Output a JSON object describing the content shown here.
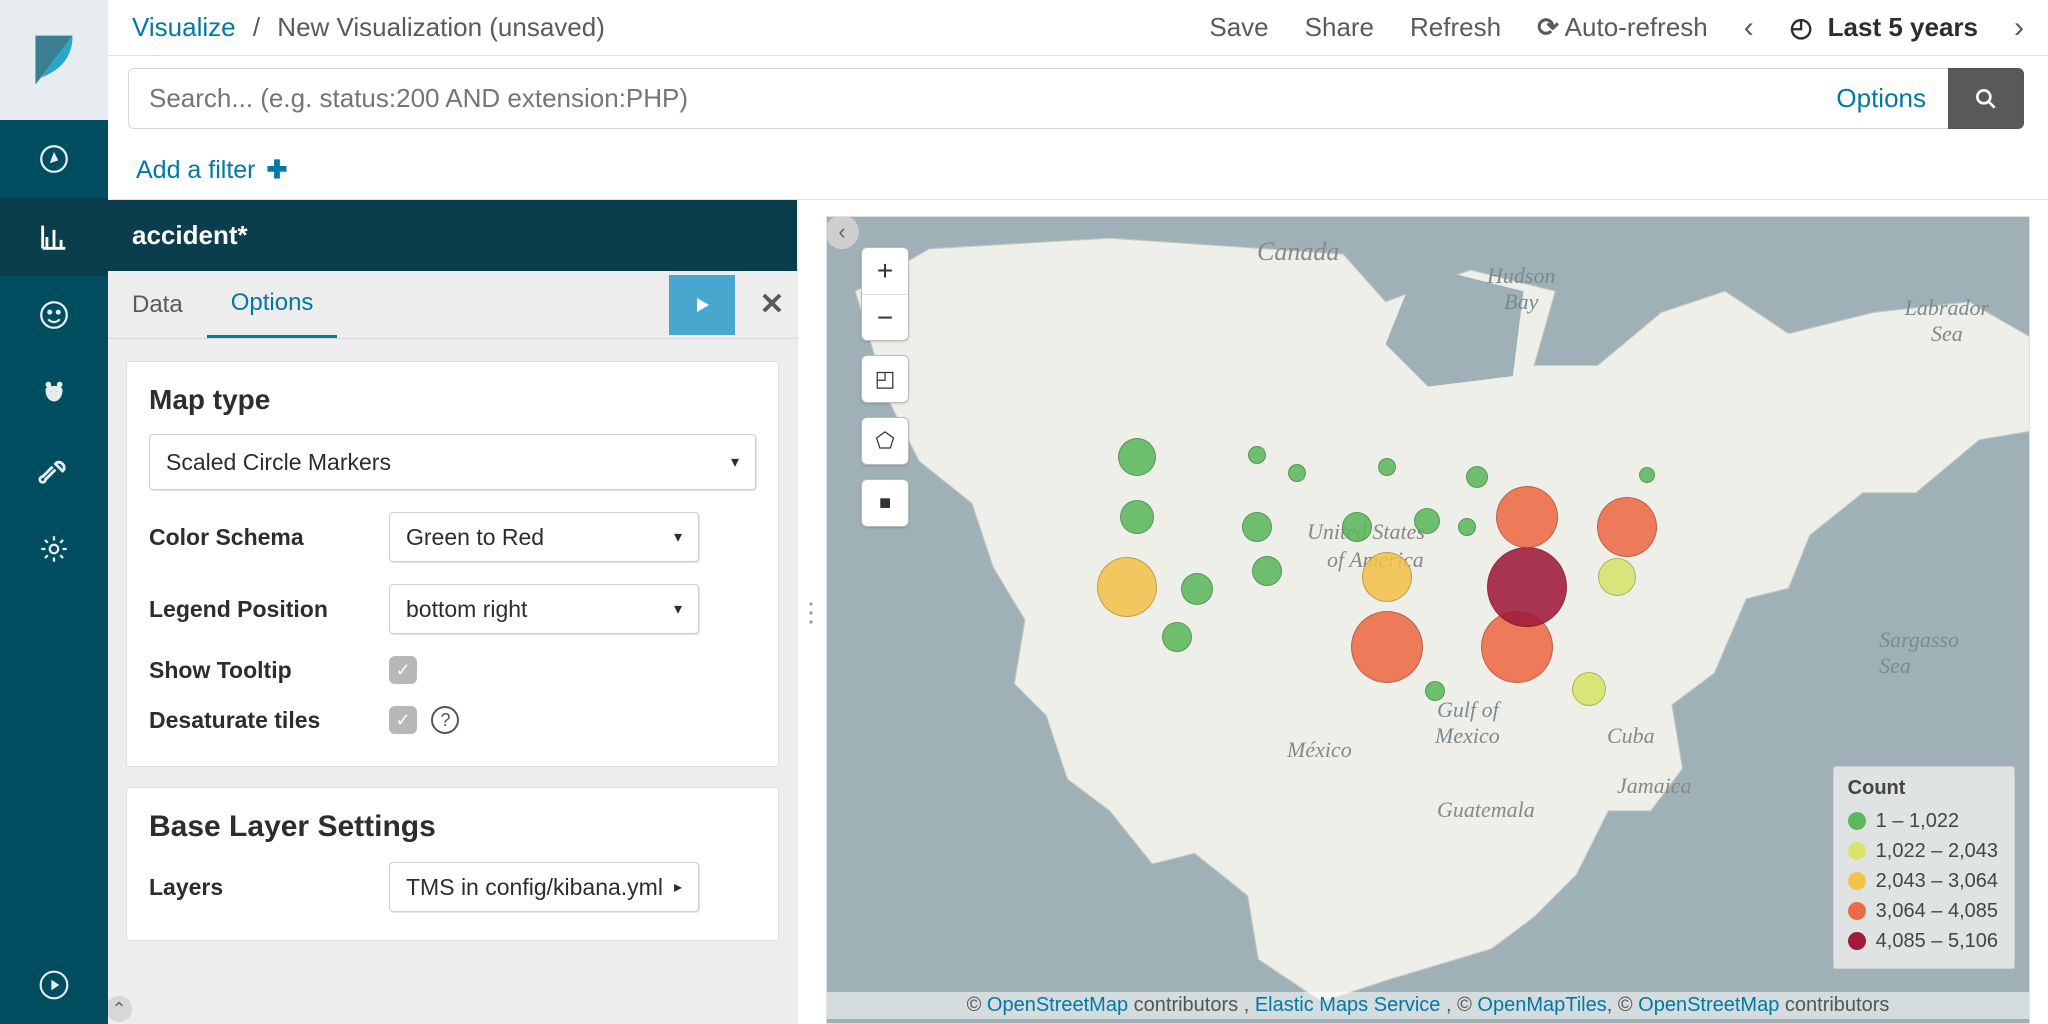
{
  "breadcrumb": {
    "root": "Visualize",
    "current": "New Visualization (unsaved)"
  },
  "top_actions": {
    "save": "Save",
    "share": "Share",
    "refresh": "Refresh",
    "autorefresh": "Auto-refresh",
    "timerange": "Last 5 years"
  },
  "search": {
    "placeholder": "Search... (e.g. status:200 AND extension:PHP)",
    "options": "Options"
  },
  "filterbar": {
    "add": "Add a filter"
  },
  "panel": {
    "index": "accident*",
    "tabs": {
      "data": "Data",
      "options": "Options"
    },
    "options": {
      "map_type_label": "Map type",
      "map_type_value": "Scaled Circle Markers",
      "color_schema_label": "Color Schema",
      "color_schema_value": "Green to Red",
      "legend_pos_label": "Legend Position",
      "legend_pos_value": "bottom right",
      "show_tooltip_label": "Show Tooltip",
      "desaturate_label": "Desaturate tiles",
      "base_layer_heading": "Base Layer Settings",
      "layers_label": "Layers",
      "layers_value": "TMS in config/kibana.yml"
    }
  },
  "map": {
    "labels": {
      "canada": "Canada",
      "hudson": "Hudson\nBay",
      "labrador": "Labrador\nSea",
      "usa1": "United States",
      "usa2": "of America",
      "mexico": "México",
      "gulf1": "Gulf of",
      "gulf2": "Mexico",
      "cuba": "Cuba",
      "jamaica": "Jamaica",
      "guatemala": "Guatemala",
      "sargasso": "Sargasso\nSea"
    },
    "legend": {
      "title": "Count",
      "ranges": [
        {
          "color": "c-g1",
          "label": "1 – 1,022"
        },
        {
          "color": "c-g2",
          "label": "1,022 – 2,043"
        },
        {
          "color": "c-g3",
          "label": "2,043 – 3,064"
        },
        {
          "color": "c-g4",
          "label": "3,064 – 4,085"
        },
        {
          "color": "c-g5",
          "label": "4,085 – 5,106"
        }
      ]
    },
    "attribution": {
      "pre": "© ",
      "osm": "OpenStreetMap",
      "mid1": " contributors , ",
      "ems": "Elastic Maps Service",
      "mid2": " , © ",
      "omt": "OpenMapTiles",
      "mid3": ", © ",
      "osm2": "OpenStreetMap",
      "post": " contributors"
    }
  }
}
